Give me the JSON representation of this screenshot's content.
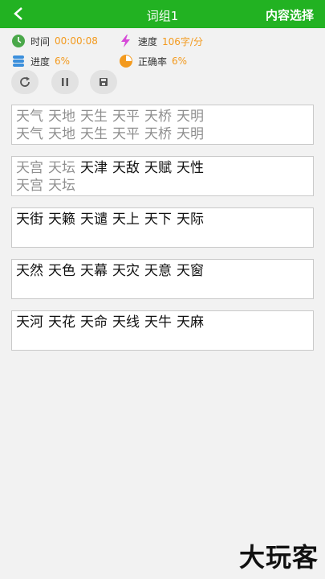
{
  "header": {
    "title": "词组1",
    "right_label": "内容选择"
  },
  "stats": {
    "time_label": "时间",
    "time_value": "00:00:08",
    "speed_label": "速度",
    "speed_value": "106字/分",
    "progress_label": "进度",
    "progress_value": "6%",
    "accuracy_label": "正确率",
    "accuracy_value": "6%"
  },
  "colors": {
    "accent": "#22b222",
    "stat_value": "#f39a1e",
    "typed": "#8f8f8f"
  },
  "icons": {
    "back": "chevron-left-icon",
    "time": "clock-icon",
    "speed": "lightning-icon",
    "progress": "stack-icon",
    "accuracy": "pie-icon",
    "restart": "refresh-icon",
    "pause": "pause-icon",
    "save": "save-icon"
  },
  "boxes": [
    {
      "target": [
        "天气",
        "天地",
        "天生",
        "天平",
        "天桥",
        "天明"
      ],
      "typed": [
        "天气",
        "天地",
        "天生",
        "天平",
        "天桥",
        "天明"
      ]
    },
    {
      "target": [
        "天宫",
        "天坛",
        "天津",
        "天敌",
        "天赋",
        "天性"
      ],
      "typed": [
        "天宫",
        "天坛"
      ]
    },
    {
      "target": [
        "天街",
        "天籁",
        "天谴",
        "天上",
        "天下",
        "天际"
      ],
      "typed": []
    },
    {
      "target": [
        "天然",
        "天色",
        "天幕",
        "天灾",
        "天意",
        "天窗"
      ],
      "typed": []
    },
    {
      "target": [
        "天河",
        "天花",
        "天命",
        "天线",
        "天牛",
        "天麻"
      ],
      "typed": []
    }
  ],
  "box_done_counts": [
    6,
    2,
    0,
    0,
    0
  ],
  "watermark": "大玩客"
}
